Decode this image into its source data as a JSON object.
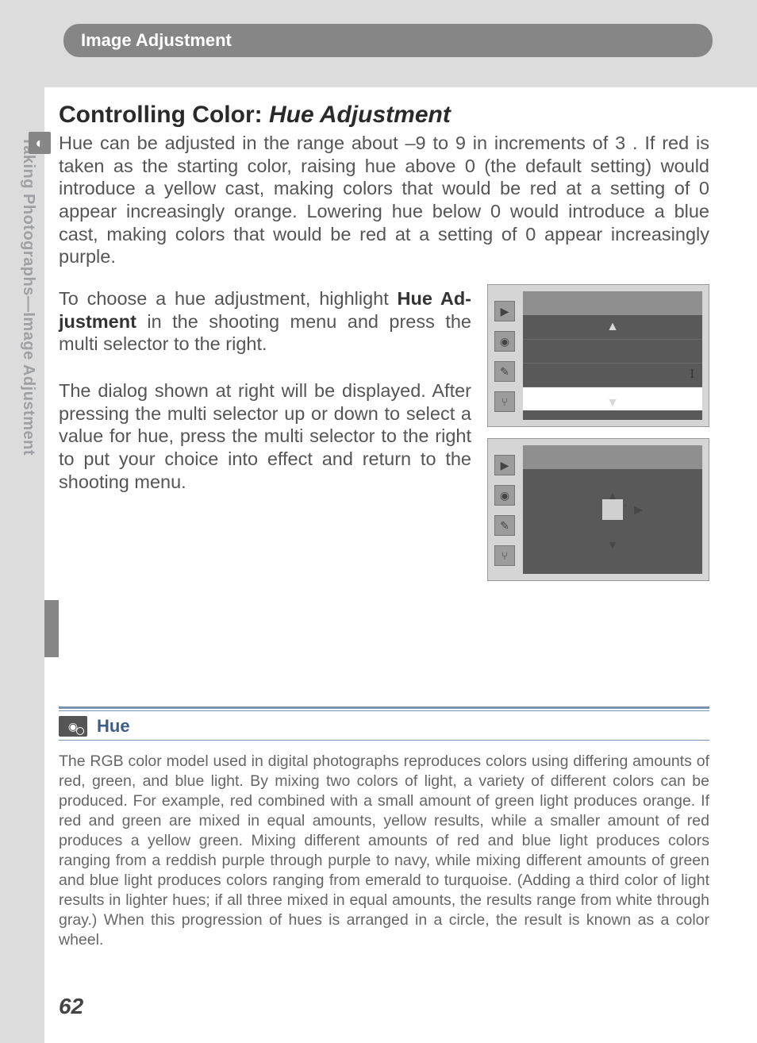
{
  "header": {
    "section_tab": "Image Adjustment",
    "vertical_text": "Taking Photographs—Image Adjustment"
  },
  "title": {
    "prefix": "Controlling Color: ",
    "italic": "Hue Adjustment"
  },
  "body": {
    "p1": "Hue can be adjusted in the range about –9  to 9  in increments of 3 .  If red is taken as the starting color, raising hue above 0  (the default setting) would introduce a yellow cast, making colors that would be red at a setting of 0  appear increasingly orange.  Lowering hue below 0  would introduce a blue cast, making colors that would be red at a setting of 0  appear increasingly purple.",
    "p2_pre": "To choose a hue adjustment, highlight ",
    "p2_bold": "Hue Ad­justment",
    "p2_post": " in the shooting menu and press the multi selector to the right.",
    "p3": "The dialog shown at right will be displayed.  After pressing the multi selector up or down to select a value for hue, press the multi selector to the right to put your choice into effect and return to the shooting menu."
  },
  "menu_icons": [
    "▶",
    "◉",
    "✎",
    "⑂"
  ],
  "fig1": {
    "arrow_up": "▲",
    "arrow_down": "▼",
    "indicator": "I"
  },
  "fig2": {
    "arrow_up": "▲",
    "arrow_down": "▼",
    "arrow_right": "▶",
    "degree": "°"
  },
  "infobox": {
    "title": "Hue",
    "text": "The RGB color model used in digital photographs reproduces colors using differing amounts of red, green, and blue light.  By mixing two colors of light, a variety of differ­ent colors can be produced.  For example, red combined with a small amount of green light produces orange.  If red and green are mixed in equal amounts, yellow results, while a smaller amount of red produces a yellow green.  Mixing different amounts of red and blue light produces colors ranging from a reddish purple through purple to navy, while mixing different amounts of green and blue light produces colors ranging from emerald to turquoise.  (Adding a third color of light results in lighter hues; if all three mixed in equal amounts, the results range from white through gray.)  When this progression of hues is arranged in a circle, the result is known as a color wheel."
  },
  "page_number": "62"
}
